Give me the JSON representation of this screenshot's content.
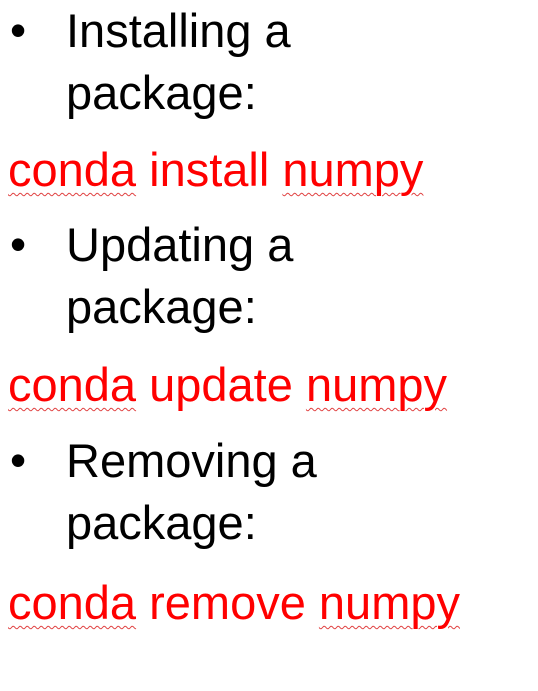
{
  "items": [
    {
      "bullet": "•",
      "heading": "Installing a package:",
      "command": {
        "tool": "conda",
        "verb": "install",
        "package": "numpy"
      }
    },
    {
      "bullet": "•",
      "heading": "Updating a package:",
      "command": {
        "tool": "conda",
        "verb": "update",
        "package": "numpy"
      }
    },
    {
      "bullet": "•",
      "heading": "Removing a package:",
      "command": {
        "tool": "conda",
        "verb": "remove",
        "package": "numpy"
      }
    }
  ],
  "colors": {
    "text": "#000000",
    "command": "#ff0000",
    "spellcheck_underline": "#e04040"
  }
}
